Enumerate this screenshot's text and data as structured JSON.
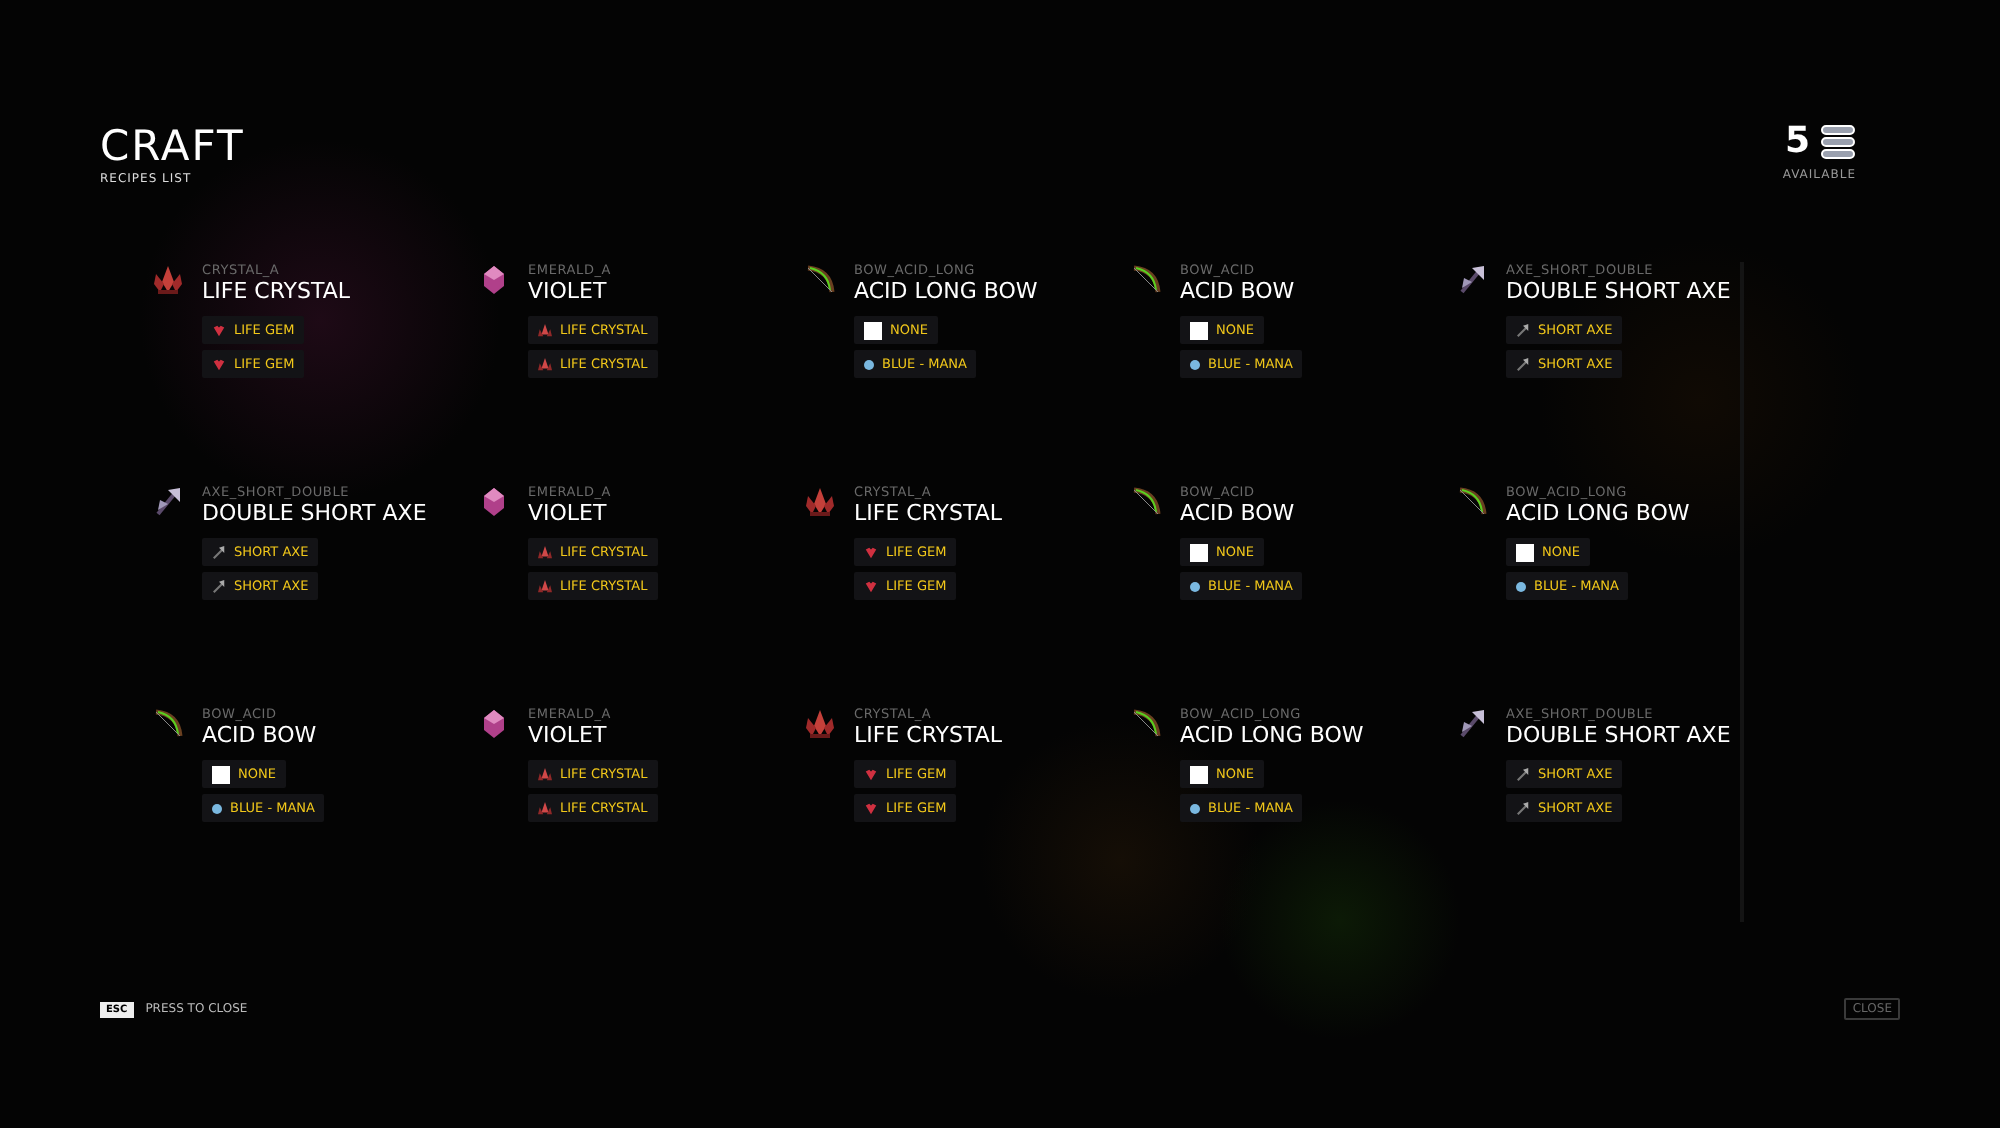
{
  "header": {
    "title": "CRAFT",
    "subtitle": "RECIPES LIST"
  },
  "available": {
    "count": "5",
    "label": "AVAILABLE"
  },
  "recipes": [
    {
      "kind": "crystal",
      "code": "CRYSTAL_A",
      "name": "LIFE CRYSTAL",
      "ingredients": [
        {
          "kind": "gem",
          "label": "LIFE GEM"
        },
        {
          "kind": "gem",
          "label": "LIFE GEM"
        }
      ]
    },
    {
      "kind": "emerald",
      "code": "EMERALD_A",
      "name": "VIOLET",
      "ingredients": [
        {
          "kind": "crystal",
          "label": "LIFE CRYSTAL"
        },
        {
          "kind": "crystal",
          "label": "LIFE CRYSTAL"
        }
      ]
    },
    {
      "kind": "bow",
      "code": "BOW_ACID_LONG",
      "name": "ACID LONG BOW",
      "ingredients": [
        {
          "kind": "none",
          "label": "NONE"
        },
        {
          "kind": "mana",
          "label": "BLUE - MANA"
        }
      ]
    },
    {
      "kind": "bow",
      "code": "BOW_ACID",
      "name": "ACID BOW",
      "ingredients": [
        {
          "kind": "none",
          "label": "NONE"
        },
        {
          "kind": "mana",
          "label": "BLUE - MANA"
        }
      ]
    },
    {
      "kind": "axe",
      "code": "AXE_SHORT_DOUBLE",
      "name": "DOUBLE SHORT AXE",
      "ingredients": [
        {
          "kind": "axe",
          "label": "SHORT AXE"
        },
        {
          "kind": "axe",
          "label": "SHORT AXE"
        }
      ]
    },
    {
      "kind": "axe",
      "code": "AXE_SHORT_DOUBLE",
      "name": "DOUBLE SHORT AXE",
      "ingredients": [
        {
          "kind": "axe",
          "label": "SHORT AXE"
        },
        {
          "kind": "axe",
          "label": "SHORT AXE"
        }
      ]
    },
    {
      "kind": "emerald",
      "code": "EMERALD_A",
      "name": "VIOLET",
      "ingredients": [
        {
          "kind": "crystal",
          "label": "LIFE CRYSTAL"
        },
        {
          "kind": "crystal",
          "label": "LIFE CRYSTAL"
        }
      ]
    },
    {
      "kind": "crystal",
      "code": "CRYSTAL_A",
      "name": "LIFE CRYSTAL",
      "ingredients": [
        {
          "kind": "gem",
          "label": "LIFE GEM"
        },
        {
          "kind": "gem",
          "label": "LIFE GEM"
        }
      ]
    },
    {
      "kind": "bow",
      "code": "BOW_ACID",
      "name": "ACID BOW",
      "ingredients": [
        {
          "kind": "none",
          "label": "NONE"
        },
        {
          "kind": "mana",
          "label": "BLUE - MANA"
        }
      ]
    },
    {
      "kind": "bow",
      "code": "BOW_ACID_LONG",
      "name": "ACID LONG BOW",
      "ingredients": [
        {
          "kind": "none",
          "label": "NONE"
        },
        {
          "kind": "mana",
          "label": "BLUE - MANA"
        }
      ]
    },
    {
      "kind": "bow",
      "code": "BOW_ACID",
      "name": "ACID BOW",
      "ingredients": [
        {
          "kind": "none",
          "label": "NONE"
        },
        {
          "kind": "mana",
          "label": "BLUE - MANA"
        }
      ]
    },
    {
      "kind": "emerald",
      "code": "EMERALD_A",
      "name": "VIOLET",
      "ingredients": [
        {
          "kind": "crystal",
          "label": "LIFE CRYSTAL"
        },
        {
          "kind": "crystal",
          "label": "LIFE CRYSTAL"
        }
      ]
    },
    {
      "kind": "crystal",
      "code": "CRYSTAL_A",
      "name": "LIFE CRYSTAL",
      "ingredients": [
        {
          "kind": "gem",
          "label": "LIFE GEM"
        },
        {
          "kind": "gem",
          "label": "LIFE GEM"
        }
      ]
    },
    {
      "kind": "bow",
      "code": "BOW_ACID_LONG",
      "name": "ACID LONG BOW",
      "ingredients": [
        {
          "kind": "none",
          "label": "NONE"
        },
        {
          "kind": "mana",
          "label": "BLUE - MANA"
        }
      ]
    },
    {
      "kind": "axe",
      "code": "AXE_SHORT_DOUBLE",
      "name": "DOUBLE SHORT AXE",
      "ingredients": [
        {
          "kind": "axe",
          "label": "SHORT AXE"
        },
        {
          "kind": "axe",
          "label": "SHORT AXE"
        }
      ]
    }
  ],
  "footer": {
    "key": "ESC",
    "hint": "PRESS TO CLOSE",
    "close_button": "CLOSE"
  }
}
